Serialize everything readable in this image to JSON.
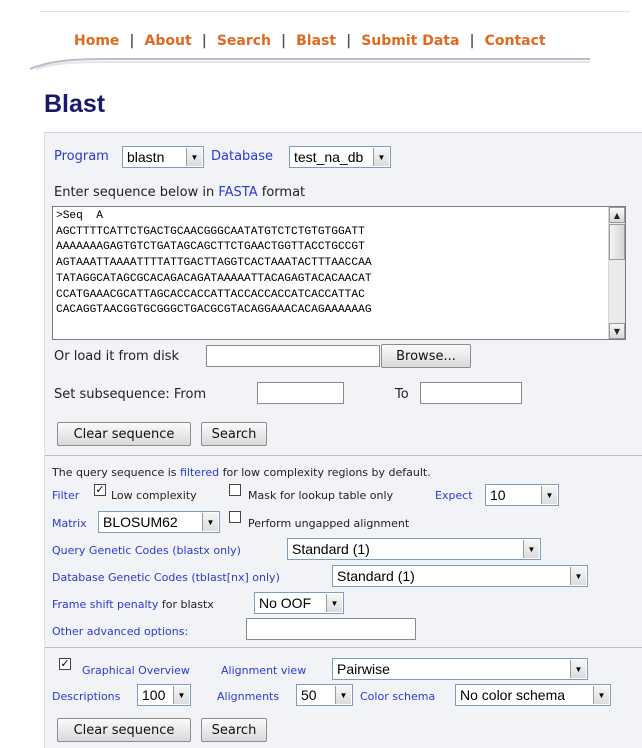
{
  "nav": {
    "items": [
      "Home",
      "About",
      "Search",
      "Blast",
      "Submit Data",
      "Contact"
    ],
    "separator": "|"
  },
  "page_title": "Blast",
  "form": {
    "program_label": "Program",
    "program_value": "blastn",
    "database_label": "Database",
    "database_value": "test_na_db",
    "enter_prefix": "Enter sequence below in",
    "enter_link": "FASTA",
    "enter_suffix": "format",
    "sequence_lines": [
      ">Seq  A",
      "AGCTTTTCATTCTGACTGCAACGGGCAATATGTCTCTGTGTGGATT",
      "AAAAAAAGAGTGTCTGATAGCAGCTTCTGAACTGGTTACCTGCCGT",
      "AGTAAATTAAAATTTTATTGACTTAGGTCACTAAATACTTTAACCAA",
      "TATAGGCATAGCGCACAGACAGATAAAAATTACAGAGTACACAACAT",
      "CCATGAAACGCATTAGCACCACCATTACCACCACCATCACCATTAC",
      "CACAGGTAACGGTGCGGGCTGACGCGTACAGGAAACACAGAAAAAAG"
    ],
    "load_label": "Or load it from disk",
    "browse_label": "Browse...",
    "subseq_label": "Set subsequence: From",
    "to_label": "To",
    "clear_label": "Clear sequence",
    "search_label": "Search"
  },
  "options": {
    "filtered_prefix": "The query sequence is",
    "filtered_link": "filtered",
    "filtered_suffix": "for low complexity regions by default.",
    "filter_label": "Filter",
    "low_complexity_label": "Low complexity",
    "low_complexity_checked": true,
    "mask_label": "Mask for lookup table only",
    "mask_checked": false,
    "expect_label": "Expect",
    "expect_value": "10",
    "matrix_label": "Matrix",
    "matrix_value": "BLOSUM62",
    "ungapped_label": "Perform ungapped alignment",
    "ungapped_checked": false,
    "query_codes_label": "Query Genetic Codes (blastx only)",
    "query_codes_value": "Standard (1)",
    "db_codes_label": "Database Genetic Codes (tblast[nx] only)",
    "db_codes_value": "Standard (1)",
    "frame_link": "Frame shift penalty",
    "frame_suffix": "for blastx",
    "frame_value": "No OOF",
    "advanced_label": "Other advanced options:",
    "advanced_value": ""
  },
  "output": {
    "graphical_checked": true,
    "graphical_label": "Graphical Overview",
    "alignment_view_label": "Alignment view",
    "alignment_view_value": "Pairwise",
    "descriptions_label": "Descriptions",
    "descriptions_value": "100",
    "alignments_label": "Alignments",
    "alignments_value": "50",
    "color_schema_label": "Color schema",
    "color_schema_value": "No color schema",
    "clear_label": "Clear sequence",
    "search_label": "Search"
  },
  "colors": {
    "nav_link": "#e06a1f",
    "title": "#18186e",
    "label_blue": "#2a3bd0",
    "panel_bg": "#f2f3f6"
  }
}
